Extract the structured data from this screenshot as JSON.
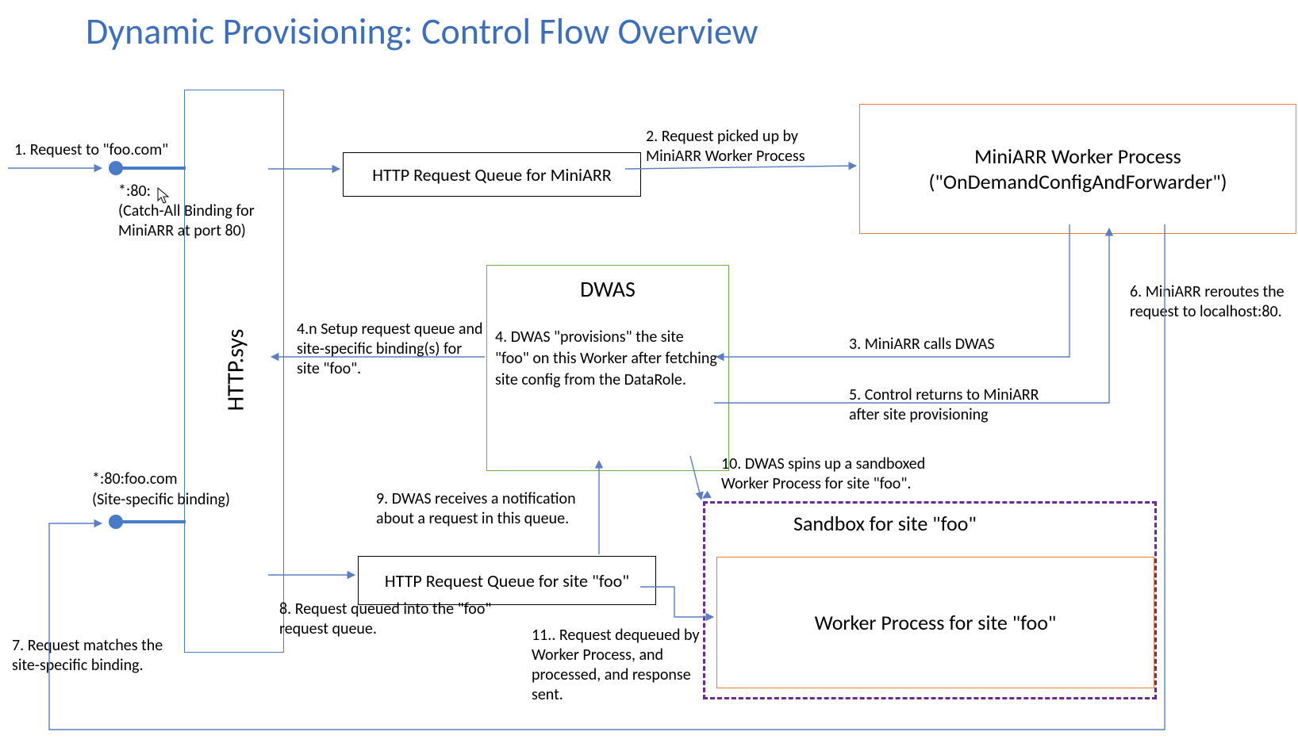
{
  "title": "Dynamic Provisioning: Control Flow Overview",
  "boxes": {
    "httpsys": "HTTP.sys",
    "miniarr_queue": "HTTP Request Queue for MiniARR",
    "miniarr_worker_line1": "MiniARR Worker Process",
    "miniarr_worker_line2": "(\"OnDemandConfigAndForwarder\")",
    "dwas_title": "DWAS",
    "dwas_body": "4. DWAS \"provisions\" the site \"foo\" on this Worker after fetching site config from the DataRole.",
    "foo_queue": "HTTP Request Queue for site \"foo\"",
    "sandbox_title": "Sandbox for site \"foo\"",
    "worker_foo": "Worker Process for site \"foo\""
  },
  "labels": {
    "step1": "1. Request to \"foo.com\"",
    "bind1a": "*:80:",
    "bind1b": "(Catch-All Binding for MiniARR at port 80)",
    "step2": "2. Request picked up by MiniARR Worker Process",
    "step3": "3. MiniARR calls DWAS",
    "step4n": "4.n Setup request queue and site-specific binding(s) for site \"foo\".",
    "step5": "5. Control returns to MiniARR after site provisioning",
    "step6": "6. MiniARR reroutes the request to localhost:80.",
    "bind2a": "*:80:foo.com",
    "bind2b": "(Site-specific binding)",
    "step7": "7. Request matches the site-specific binding.",
    "step8": "8. Request queued into the \"foo\" request queue.",
    "step9": "9. DWAS receives a notification about a request in this queue.",
    "step10": "10. DWAS spins up a sandboxed Worker Process for site \"foo\".",
    "step11": "11.. Request dequeued by Worker Process, and processed, and response sent."
  },
  "colors": {
    "blue": "#4a7bc7",
    "orange": "#ed7d31",
    "green": "#70ad47",
    "purple": "#6b2a94",
    "black": "#000000"
  }
}
